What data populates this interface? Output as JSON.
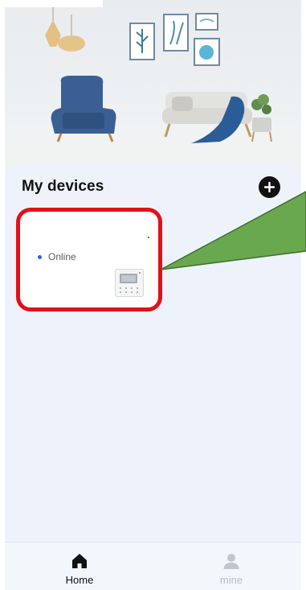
{
  "section": {
    "title": "My devices"
  },
  "device": {
    "status": "Online"
  },
  "tabbar": {
    "home_label": "Home",
    "mine_label": "mine"
  },
  "colors": {
    "card_border": "#e3101a",
    "online_dot": "#2e63c9",
    "callout": "#6aa84f"
  },
  "icons": {
    "add": "plus-circle-icon",
    "home": "house-icon",
    "mine": "person-icon",
    "device": "thermostat-icon"
  }
}
